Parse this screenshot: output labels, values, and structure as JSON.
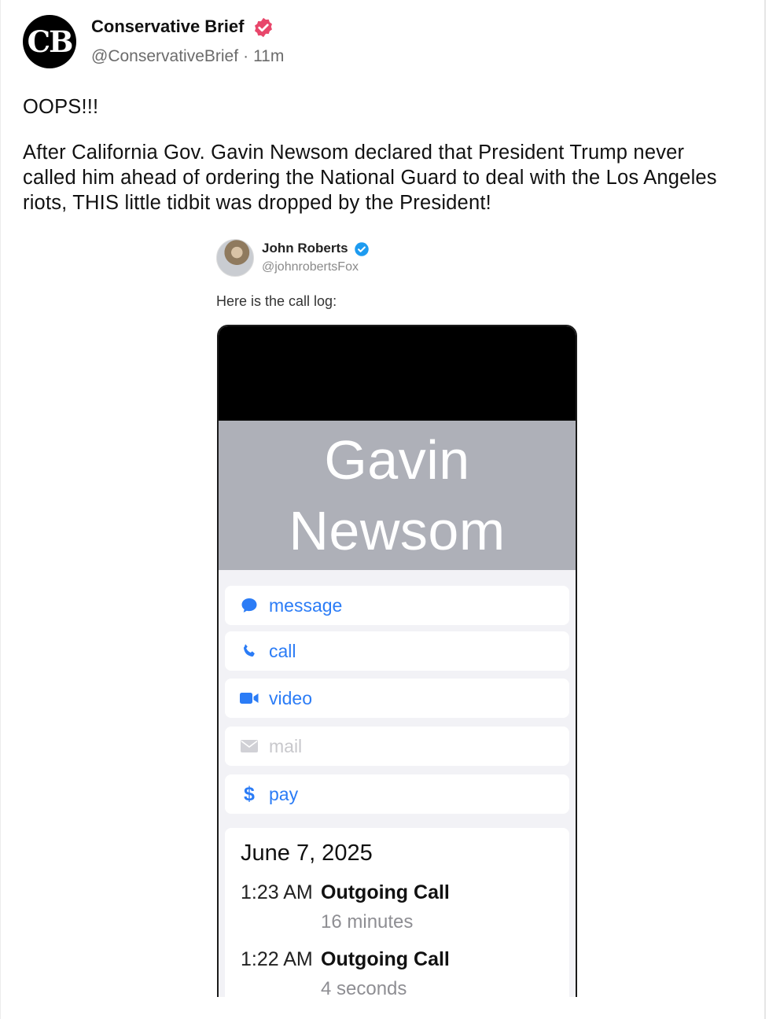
{
  "post": {
    "avatar_text": "CB",
    "author_name": "Conservative Brief",
    "handle": "@ConservativeBrief",
    "separator": "·",
    "time": "11m",
    "paragraphs": [
      "OOPS!!!",
      "After California Gov. Gavin Newsom declared that President Trump never called him ahead of ordering the National Guard to deal with the Los Angeles riots, THIS little tidbit was dropped by the President!"
    ]
  },
  "embed": {
    "author_name": "John Roberts",
    "handle": "@johnrobertsFox",
    "text": "Here is the call log:",
    "contact": {
      "name_line1": "Gavin",
      "name_line2": "Newsom"
    },
    "actions": [
      {
        "label": "message",
        "icon": "message-bubble-icon",
        "enabled": true
      },
      {
        "label": "call",
        "icon": "phone-icon",
        "enabled": true
      },
      {
        "label": "video",
        "icon": "video-camera-icon",
        "enabled": true
      },
      {
        "label": "mail",
        "icon": "mail-icon",
        "enabled": false
      },
      {
        "label": "pay",
        "icon": "dollar-icon",
        "enabled": true
      }
    ],
    "calls": {
      "date": "June 7, 2025",
      "entries": [
        {
          "time": "1:23 AM",
          "type": "Outgoing Call",
          "duration": "16 minutes"
        },
        {
          "time": "1:22 AM",
          "type": "Outgoing Call",
          "duration": "4 seconds"
        }
      ]
    }
  },
  "colors": {
    "verified_pink": "#e8476b",
    "verified_blue": "#1d9bf0",
    "ios_blue": "#2b7cf6",
    "contact_header": "#aeb0b8"
  }
}
